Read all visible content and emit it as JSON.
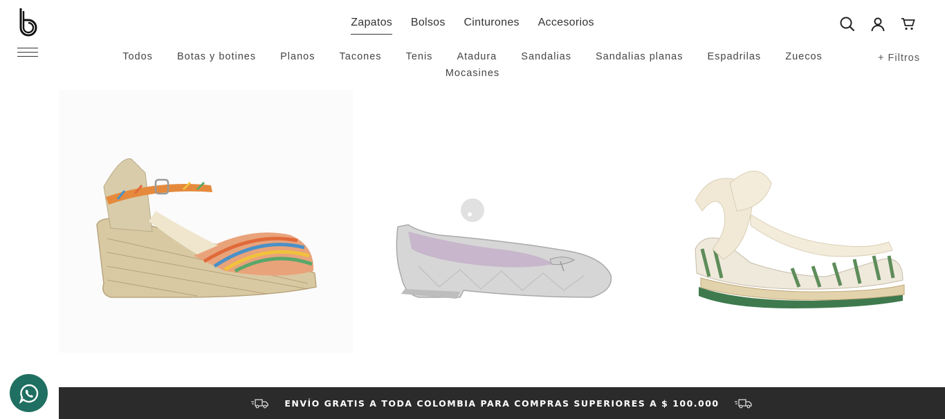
{
  "header": {
    "logo_icon": "b-logo-icon",
    "menu_icon": "hamburger-icon",
    "main_nav": [
      {
        "label": "Zapatos",
        "active": true
      },
      {
        "label": "Bolsos",
        "active": false
      },
      {
        "label": "Cinturones",
        "active": false
      },
      {
        "label": "Accesorios",
        "active": false
      }
    ],
    "icons": [
      "search-icon",
      "user-icon",
      "cart-icon"
    ]
  },
  "sub_nav": {
    "items": [
      "Todos",
      "Botas y botines",
      "Planos",
      "Tacones",
      "Tenis",
      "Atadura",
      "Sandalias",
      "Sandalias planas",
      "Espadrilas",
      "Zuecos",
      "Mocasines"
    ],
    "filters_label": "+ Filtros"
  },
  "products": [
    {
      "image": "espadrille-wedge-multicolor"
    },
    {
      "image": "silver-ballet-flat"
    },
    {
      "image": "lace-up-striped-espadrille"
    }
  ],
  "whatsapp_icon": "whatsapp-icon",
  "banner": {
    "text": "ENVÍO GRATIS A TODA COLOMBIA PARA COMPRAS SUPERIORES A $ 100.000",
    "icon": "truck-icon"
  },
  "colors": {
    "banner_bg": "#2b2b2b",
    "whatsapp": "#1f6f62",
    "text": "#333333"
  }
}
